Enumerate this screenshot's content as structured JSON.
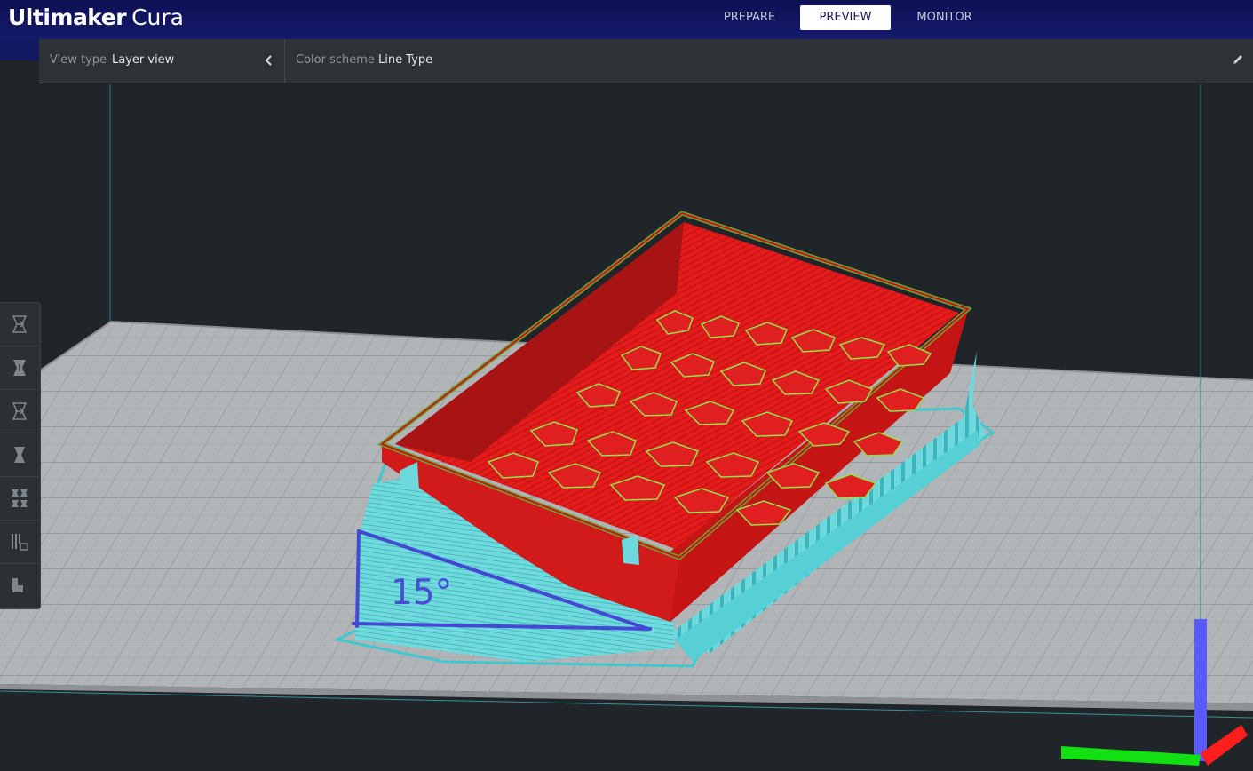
{
  "app": {
    "brand": "Ultimaker",
    "product": "Cura"
  },
  "stages": [
    {
      "label": "PREPARE",
      "active": false
    },
    {
      "label": "PREVIEW",
      "active": true
    },
    {
      "label": "MONITOR",
      "active": false
    }
  ],
  "view_bar": {
    "view_type_label": "View type",
    "view_type_value": "Layer view",
    "color_scheme_label": "Color scheme",
    "color_scheme_value": "Line Type"
  },
  "tools": [
    {
      "name": "move-tool",
      "icon": "move-icon"
    },
    {
      "name": "scale-tool",
      "icon": "scale-icon"
    },
    {
      "name": "rotate-tool",
      "icon": "rotate-icon"
    },
    {
      "name": "mirror-tool",
      "icon": "mirror-icon"
    },
    {
      "name": "per-model-settings-tool",
      "icon": "per-model-settings-icon"
    },
    {
      "name": "support-blocker-tool",
      "icon": "support-blocker-icon"
    },
    {
      "name": "layflat-tool",
      "icon": "layflat-icon"
    }
  ],
  "annotation": {
    "angle_text": "15°",
    "color": "#4a4dd4"
  },
  "colors": {
    "header": "#12165e",
    "wall_outer": "#e31a1a",
    "support": "#5fd8dc",
    "infill_outline": "#7fe04a",
    "axis_x": "#ff2020",
    "axis_y": "#10e010",
    "axis_z": "#5a5aff"
  }
}
